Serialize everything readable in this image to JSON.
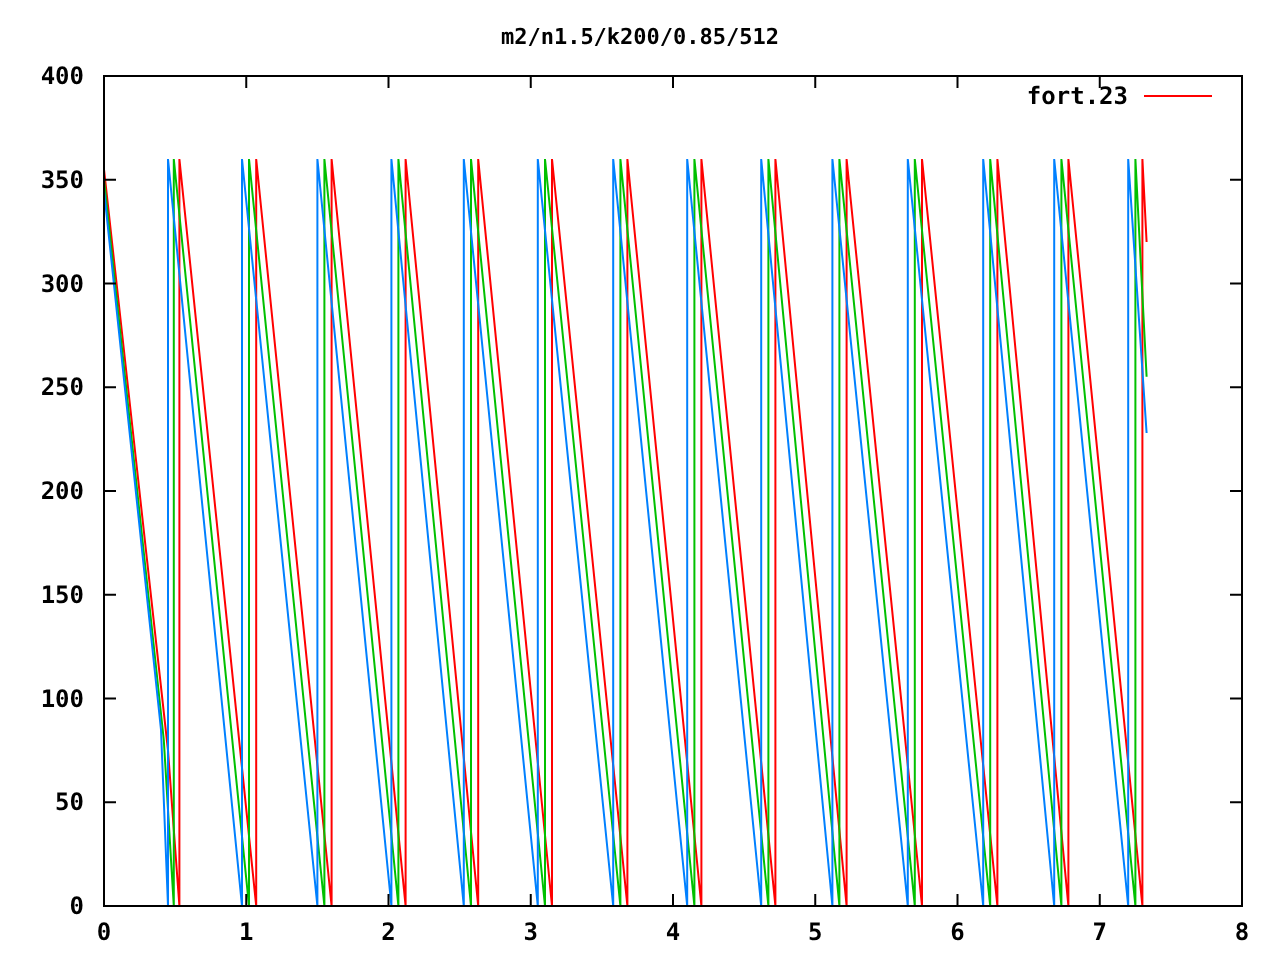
{
  "chart_data": {
    "type": "line",
    "title": "m2/n1.5/k200/0.85/512",
    "xlim": [
      0,
      8
    ],
    "ylim": [
      0,
      400
    ],
    "xticks": [
      0,
      1,
      2,
      3,
      4,
      5,
      6,
      7,
      8
    ],
    "yticks": [
      0,
      50,
      100,
      150,
      200,
      250,
      300,
      350,
      400
    ],
    "series": [
      {
        "name": "fort.23",
        "color": "#ff0000",
        "x": [
          0,
          0.45,
          0.53,
          0.53,
          1.07,
          1.07,
          1.6,
          1.6,
          2.12,
          2.12,
          2.63,
          2.63,
          3.15,
          3.15,
          3.68,
          3.68,
          4.2,
          4.2,
          4.72,
          4.72,
          5.22,
          5.22,
          5.75,
          5.75,
          6.28,
          6.28,
          6.78,
          6.78,
          7.3,
          7.3,
          7.33
        ],
        "values": [
          355,
          75,
          0,
          360,
          0,
          360,
          0,
          360,
          0,
          360,
          0,
          360,
          0,
          360,
          0,
          360,
          0,
          360,
          0,
          360,
          0,
          360,
          0,
          360,
          0,
          360,
          0,
          360,
          0,
          360,
          320
        ]
      },
      {
        "name": null,
        "color": "#00c000",
        "x": [
          0,
          0.42,
          0.49,
          0.49,
          1.02,
          1.02,
          1.55,
          1.55,
          2.07,
          2.07,
          2.58,
          2.58,
          3.1,
          3.1,
          3.63,
          3.63,
          4.15,
          4.15,
          4.67,
          4.67,
          5.17,
          5.17,
          5.7,
          5.7,
          6.23,
          6.23,
          6.73,
          6.73,
          7.25,
          7.25,
          7.33
        ],
        "values": [
          350,
          80,
          0,
          360,
          0,
          360,
          0,
          360,
          0,
          360,
          0,
          360,
          0,
          360,
          0,
          360,
          0,
          360,
          0,
          360,
          0,
          360,
          0,
          360,
          0,
          360,
          0,
          360,
          0,
          360,
          255
        ]
      },
      {
        "name": null,
        "color": "#0080ff",
        "x": [
          0,
          0.4,
          0.45,
          0.45,
          0.97,
          0.97,
          1.5,
          1.5,
          2.02,
          2.02,
          2.53,
          2.53,
          3.05,
          3.05,
          3.58,
          3.58,
          4.1,
          4.1,
          4.62,
          4.62,
          5.12,
          5.12,
          5.65,
          5.65,
          6.18,
          6.18,
          6.68,
          6.68,
          7.2,
          7.2,
          7.33
        ],
        "values": [
          345,
          85,
          0,
          360,
          0,
          360,
          0,
          360,
          0,
          360,
          0,
          360,
          0,
          360,
          0,
          360,
          0,
          360,
          0,
          360,
          0,
          360,
          0,
          360,
          0,
          360,
          0,
          360,
          0,
          360,
          228
        ]
      }
    ]
  }
}
